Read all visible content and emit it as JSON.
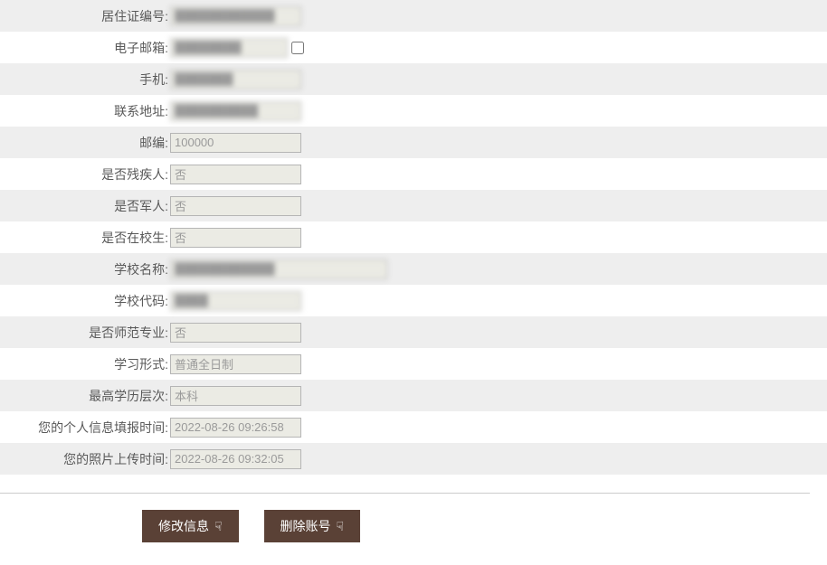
{
  "fields": {
    "residence_permit": {
      "label": "居住证编号:",
      "value": "████████████"
    },
    "email": {
      "label": "电子邮箱:",
      "value": "████████"
    },
    "phone": {
      "label": "手机:",
      "value": "███████"
    },
    "address": {
      "label": "联系地址:",
      "value": "██████████"
    },
    "postcode": {
      "label": "邮编:",
      "value": "100000"
    },
    "disabled": {
      "label": "是否残疾人:",
      "value": "否"
    },
    "military": {
      "label": "是否军人:",
      "value": "否"
    },
    "student": {
      "label": "是否在校生:",
      "value": "否"
    },
    "school_name": {
      "label": "学校名称:",
      "value": "████████████"
    },
    "school_code": {
      "label": "学校代码:",
      "value": "████"
    },
    "normal_major": {
      "label": "是否师范专业:",
      "value": "否"
    },
    "study_form": {
      "label": "学习形式:",
      "value": "普通全日制"
    },
    "highest_edu": {
      "label": "最高学历层次:",
      "value": "本科"
    },
    "info_time": {
      "label": "您的个人信息填报时间:",
      "value": "2022-08-26 09:26:58"
    },
    "photo_time": {
      "label": "您的照片上传时间:",
      "value": "2022-08-26 09:32:05"
    }
  },
  "buttons": {
    "edit": "修改信息",
    "delete": "删除账号"
  }
}
